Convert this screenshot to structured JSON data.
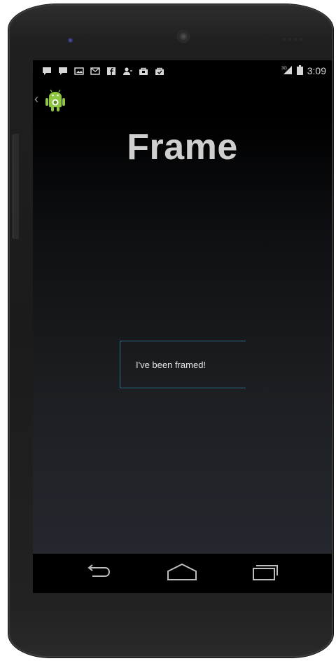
{
  "status_bar": {
    "time": "3:09",
    "network": "3G",
    "notification_icons": [
      "chat-icon",
      "chat-icon",
      "image-icon",
      "gmail-icon",
      "facebook-icon",
      "person-add-icon",
      "store-icon",
      "store-check-icon"
    ]
  },
  "app_bar": {
    "icon": "android-robot-icon"
  },
  "main": {
    "title": "Frame",
    "framed_text": "I've been framed!"
  },
  "nav_bar": {
    "buttons": [
      "back-icon",
      "home-icon",
      "recents-icon"
    ]
  },
  "colors": {
    "frame_border": "#2a6f84",
    "title": "#cfcfcf",
    "android_green": "#8dc63f"
  }
}
